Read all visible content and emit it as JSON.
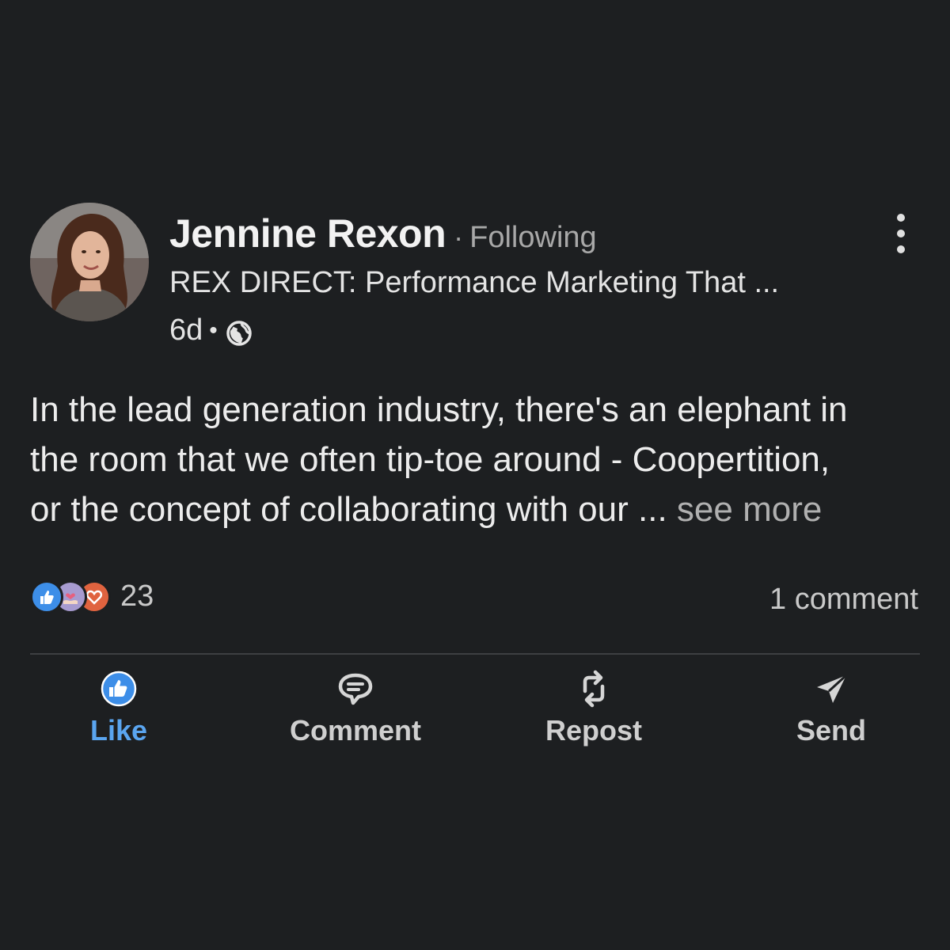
{
  "post": {
    "author": {
      "name": "Jennine Rexon",
      "separator": "·",
      "follow_status": "Following",
      "headline": "REX DIRECT: Performance Marketing That ...",
      "timestamp": "6d",
      "meta_separator": "•",
      "visibility_icon": "globe-icon"
    },
    "text_lines": [
      "In the lead generation industry, there's an elephant in",
      "the room that we often tip-toe around - Coopertition,",
      "or the concept of collaborating with our ..."
    ],
    "see_more": "see more",
    "reactions": {
      "icons": [
        "like-reaction-icon",
        "support-reaction-icon",
        "love-reaction-icon"
      ],
      "count": "23"
    },
    "comments": "1 comment"
  },
  "actions": [
    {
      "label": "Like",
      "icon": "thumbs-up-icon",
      "active": true,
      "color": "#5aa5f0"
    },
    {
      "label": "Comment",
      "icon": "comment-bubble-icon"
    },
    {
      "label": "Repost",
      "icon": "repost-icon"
    },
    {
      "label": "Send",
      "icon": "send-icon"
    }
  ],
  "colors": {
    "background": "#1d1f21",
    "like_blue": "#3d8ee8",
    "love_orange": "#e0633f",
    "support_purple": "#a79bd0"
  }
}
